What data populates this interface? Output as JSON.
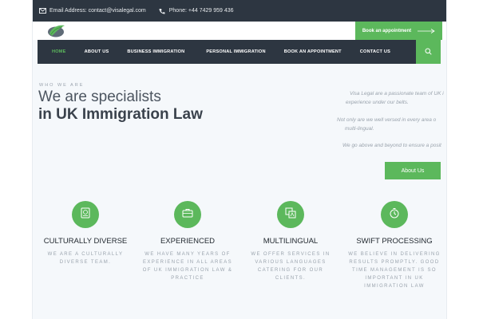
{
  "topbar": {
    "email_label": "Email Address:",
    "email_value": "contact@visalegal.com",
    "phone_label": "Phone:",
    "phone_value": "+44 7429 959 436"
  },
  "header": {
    "book_label": "Book an appointment"
  },
  "nav": {
    "items": [
      "HOME",
      "ABOUT US",
      "BUSINESS IMMIGRATION",
      "PERSONAL IMMIGRATION",
      "BOOK AN APPOINTMENT",
      "CONTACT US"
    ],
    "active": "HOME"
  },
  "hero": {
    "eyebrow": "WHO WE ARE",
    "title_line1": "We are specialists",
    "title_line2": "in UK Immigration Law",
    "para1": "Visa Legal are a passionate team of UK i",
    "para2": "experience under our belts.",
    "para3": "Not only are we well versed in every area o",
    "para4": "multi-lingual.",
    "para5": "We go above and beyond to ensure a posit",
    "about_label": "About Us"
  },
  "features": [
    {
      "title": "CULTURALLY DIVERSE",
      "desc_lines": [
        "WE ARE A CULTURALLY",
        "DIVERSE TEAM."
      ],
      "icon": "passport-icon"
    },
    {
      "title": "EXPERIENCED",
      "desc_lines": [
        "WE HAVE MANY YEARS OF",
        "EXPERIENCE IN ALL AREAS",
        "OF UK IMMIGRATION LAW &",
        "PRACTICE"
      ],
      "icon": "briefcase-icon"
    },
    {
      "title": "MULTILINGUAL",
      "desc_lines": [
        "WE OFFER SERVICES IN",
        "VARIOUS LANGUAGES",
        "CATERING FOR OUR",
        "CLIENTS."
      ],
      "icon": "translate-icon"
    },
    {
      "title": "SWIFT PROCESSING",
      "desc_lines": [
        "WE BELIEVE IN DELIVERING",
        "RESULTS PROMPTLY. GOOD",
        "TIME MANAGEMENT IS SO",
        "IMPORTANT IN UK",
        "IMMIGRATION LAW"
      ],
      "icon": "stopwatch-icon"
    }
  ],
  "colors": {
    "accent": "#5cb85c",
    "dark": "#2d3641",
    "text_muted": "#9aa3ad"
  }
}
